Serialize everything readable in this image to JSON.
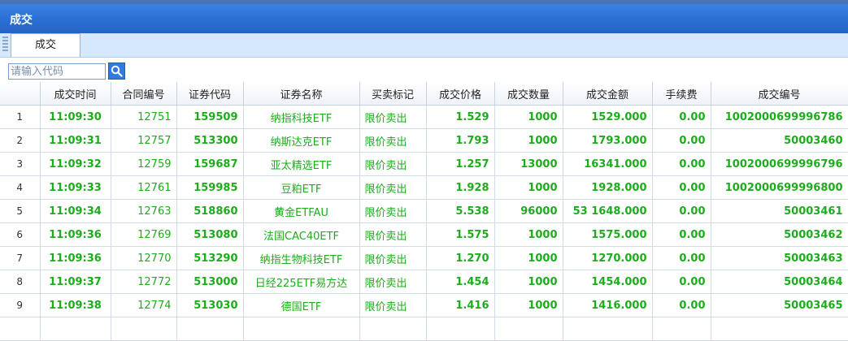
{
  "window": {
    "title": "成交"
  },
  "tabs": [
    {
      "label": "成交"
    }
  ],
  "search": {
    "placeholder": "请输入代码",
    "value": ""
  },
  "table": {
    "columns": [
      "",
      "成交时间",
      "合同编号",
      "证券代码",
      "证券名称",
      "买卖标记",
      "成交价格",
      "成交数量",
      "成交金额",
      "手续费",
      "成交编号"
    ],
    "rows": [
      [
        "1",
        "11:09:30",
        "12751",
        "159509",
        "纳指科技ETF",
        "限价卖出",
        "1.529",
        "1000",
        "1529.000",
        "0.00",
        "1002000699996786"
      ],
      [
        "2",
        "11:09:31",
        "12757",
        "513300",
        "纳斯达克ETF",
        "限价卖出",
        "1.793",
        "1000",
        "1793.000",
        "0.00",
        "50003460"
      ],
      [
        "3",
        "11:09:32",
        "12759",
        "159687",
        "亚太精选ETF",
        "限价卖出",
        "1.257",
        "13000",
        "16341.000",
        "0.00",
        "1002000699996796"
      ],
      [
        "4",
        "11:09:33",
        "12761",
        "159985",
        "豆粕ETF",
        "限价卖出",
        "1.928",
        "1000",
        "1928.000",
        "0.00",
        "1002000699996800"
      ],
      [
        "5",
        "11:09:34",
        "12763",
        "518860",
        "黄金ETFAU",
        "限价卖出",
        "5.538",
        "96000",
        "53 1648.000",
        "0.00",
        "50003461"
      ],
      [
        "6",
        "11:09:36",
        "12769",
        "513080",
        "法国CAC40ETF",
        "限价卖出",
        "1.575",
        "1000",
        "1575.000",
        "0.00",
        "50003462"
      ],
      [
        "7",
        "11:09:36",
        "12770",
        "513290",
        "纳指生物科技ETF",
        "限价卖出",
        "1.270",
        "1000",
        "1270.000",
        "0.00",
        "50003463"
      ],
      [
        "8",
        "11:09:37",
        "12772",
        "513000",
        "日经225ETF易方达",
        "限价卖出",
        "1.454",
        "1000",
        "1454.000",
        "0.00",
        "50003464"
      ],
      [
        "9",
        "11:09:38",
        "12774",
        "513030",
        "德国ETF",
        "限价卖出",
        "1.416",
        "1000",
        "1416.000",
        "0.00",
        "50003465"
      ]
    ]
  },
  "colors": {
    "titlebar": "#2a6fd3",
    "value_text": "#1cac1c",
    "tabbar": "#d6e8fb"
  },
  "icons": {
    "search": "search-icon",
    "grip": "grip-icon"
  }
}
